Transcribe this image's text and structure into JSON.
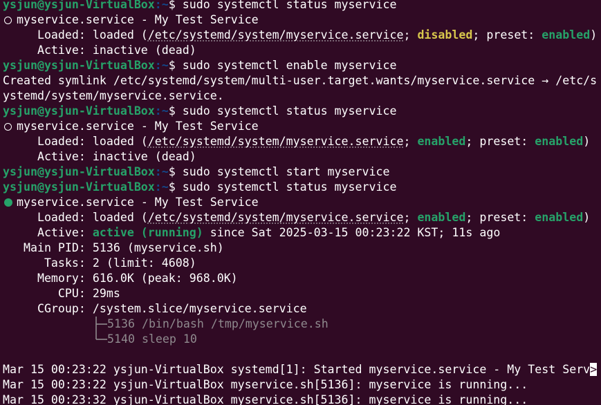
{
  "prompt": {
    "user": "ysjun@ysjun-VirtualBox",
    "path": ":~",
    "dollar": "$ "
  },
  "commands": {
    "c1": "sudo systemctl status myservice",
    "c2": "sudo systemctl enable myservice",
    "c3": "sudo systemctl status myservice",
    "c4": "sudo systemctl start myservice",
    "c5": "sudo systemctl status myservice"
  },
  "status1": {
    "title": "myservice.service - My Test Service",
    "loaded_label": "     Loaded: ",
    "loaded_pre": "loaded (",
    "loaded_path": "/etc/systemd/system/myservice.service",
    "loaded_sep": "; ",
    "loaded_state": "disabled",
    "preset_label": "; preset: ",
    "preset_state": "enabled",
    "loaded_end": ")",
    "active_label": "     Active: ",
    "active_value": "inactive (dead)"
  },
  "enable_output": {
    "line1": "Created symlink /etc/systemd/system/multi-user.target.wants/myservice.service → /etc/s",
    "line2": "ystemd/system/myservice.service."
  },
  "status2": {
    "title": "myservice.service - My Test Service",
    "loaded_label": "     Loaded: ",
    "loaded_pre": "loaded (",
    "loaded_path": "/etc/systemd/system/myservice.service",
    "loaded_sep": "; ",
    "loaded_state": "enabled",
    "preset_label": "; preset: ",
    "preset_state": "enabled",
    "loaded_end": ")",
    "active_label": "     Active: ",
    "active_value": "inactive (dead)"
  },
  "status3": {
    "title": "myservice.service - My Test Service",
    "loaded_label": "     Loaded: ",
    "loaded_pre": "loaded (",
    "loaded_path": "/etc/systemd/system/myservice.service",
    "loaded_sep": "; ",
    "loaded_state": "enabled",
    "preset_label": "; preset: ",
    "preset_state": "enabled",
    "loaded_end": ")",
    "active_label": "     Active: ",
    "active_state": "active (running)",
    "active_since": " since Sat 2025-03-15 00:23:22 KST; 11s ago",
    "pid_label": "   Main PID: ",
    "pid_value": "5136 (myservice.sh)",
    "tasks_label": "      Tasks: ",
    "tasks_value": "2 (limit: 4608)",
    "memory_label": "     Memory: ",
    "memory_value": "616.0K (peak: 968.0K)",
    "cpu_label": "        CPU: ",
    "cpu_value": "29ms",
    "cgroup_label": "     CGroup: ",
    "cgroup_value": "/system.slice/myservice.service",
    "proc1": "5136 /bin/bash /tmp/myservice.sh",
    "proc2": "5140 sleep 10"
  },
  "log": {
    "l1_text": "Mar 15 00:23:22 ysjun-VirtualBox systemd[1]: Started myservice.service - My Test Serv",
    "l1_more": ">",
    "l2": "Mar 15 00:23:22 ysjun-VirtualBox myservice.sh[5136]: myservice is running...",
    "l3": "Mar 15 00:23:32 ysjun-VirtualBox myservice.sh[5136]: myservice is running..."
  },
  "colors": {
    "background": "#300a24",
    "green": "#26a269",
    "blue": "#12488b",
    "yellow": "#d8c74c"
  }
}
